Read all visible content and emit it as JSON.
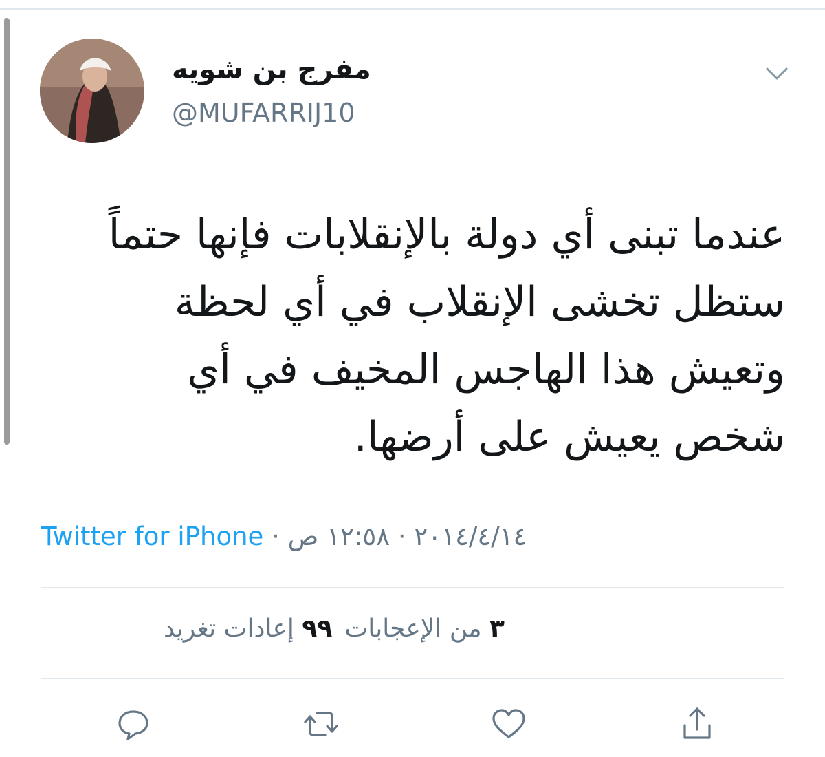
{
  "author": {
    "display_name": "مفرج بن شويه",
    "username": "@MUFARRIJ10"
  },
  "tweet": {
    "lines": [
      "عندما تبنى أي دولة بالإنقلابات فإنها حتماً",
      "ستظل تخشى الإنقلاب في أي لحظة",
      "وتعيش هذا الهاجس المخيف في أي",
      "شخص يعيش على أرضها."
    ]
  },
  "meta": {
    "time": "١٢:٥٨ ص",
    "separator": "·",
    "date": "٢٠١٤/٤/١٤",
    "source": "Twitter for iPhone"
  },
  "stats": {
    "retweet_count": "٩٩",
    "retweet_label": "إعادات تغريد",
    "like_count": "٣",
    "like_label": "من الإعجابات"
  },
  "icons": {
    "menu": "chevron-down-icon",
    "reply": "reply-icon",
    "retweet": "retweet-icon",
    "like": "heart-icon",
    "share": "share-icon"
  },
  "colors": {
    "link": "#1da1f2",
    "secondary_text": "#657786",
    "icon": "#657786"
  }
}
